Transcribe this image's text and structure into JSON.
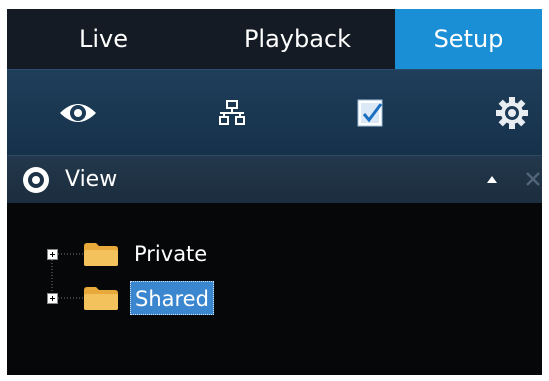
{
  "tabs": [
    {
      "label": "Live"
    },
    {
      "label": "Playback"
    },
    {
      "label": "Setup",
      "active": true
    }
  ],
  "toolbar": {
    "icons": [
      "eye-icon",
      "network-icon",
      "checklist-icon",
      "gear-icon"
    ]
  },
  "panel": {
    "title": "View",
    "icon": "eye-icon"
  },
  "tree": {
    "items": [
      {
        "label": "Private",
        "selected": false
      },
      {
        "label": "Shared",
        "selected": true
      }
    ]
  },
  "colors": {
    "accent": "#1b8fd6",
    "selection": "#3a86cf",
    "background": "#050709"
  }
}
